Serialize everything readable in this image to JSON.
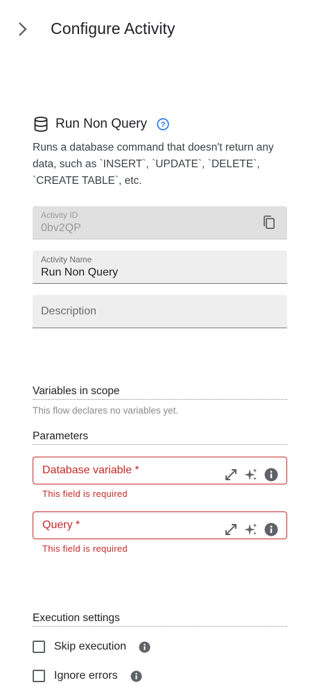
{
  "header": {
    "title": "Configure Activity"
  },
  "activity": {
    "name": "Run Non Query",
    "description": "Runs a database command that doesn't return any data, such as `INSERT`, `UPDATE`, `DELETE`, `CREATE TABLE`, etc."
  },
  "fields": {
    "activity_id": {
      "label": "Activity ID",
      "value": "0bv2QP"
    },
    "activity_name": {
      "label": "Activity Name",
      "value": "Run Non Query"
    },
    "description": {
      "placeholder": "Description"
    }
  },
  "variables": {
    "title": "Variables in scope",
    "empty_text": "This flow declares no variables yet."
  },
  "parameters": {
    "title": "Parameters",
    "items": [
      {
        "label": "Database variable *",
        "error": "This field is required"
      },
      {
        "label": "Query *",
        "error": "This field is required"
      }
    ]
  },
  "execution": {
    "title": "Execution settings",
    "options": [
      {
        "label": "Skip execution",
        "checked": false
      },
      {
        "label": "Ignore errors",
        "checked": false
      }
    ]
  },
  "colors": {
    "error": "#c62828",
    "accent": "#1a73e8"
  }
}
